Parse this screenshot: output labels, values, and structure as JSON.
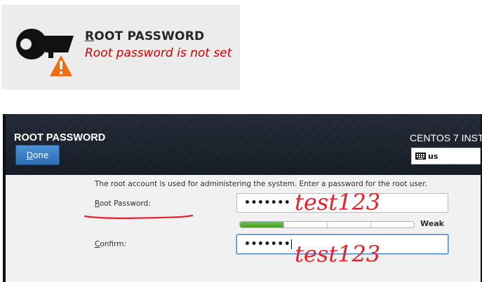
{
  "spoke": {
    "title_first": "R",
    "title_rest": "OOT PASSWORD",
    "status": "Root password is not set",
    "status_color": "#cc0000",
    "icon": "key-warning-icon"
  },
  "dialog": {
    "header_title": "ROOT PASSWORD",
    "done_first": "D",
    "done_rest": "one",
    "product": "CENTOS 7 INST",
    "keyboard_layout": "us",
    "keyboard_icon": "keyboard-icon",
    "accent": "#3a7ac4"
  },
  "form": {
    "description": "The root account is used for administering the system.  Enter a password for the root user.",
    "root_label_first": "R",
    "root_label_rest": "oot Password:",
    "root_value": "•••••••",
    "confirm_label_first": "C",
    "confirm_label_rest": "onfirm:",
    "confirm_value": "•••••••",
    "strength_label": "Weak",
    "strength_level": 0.25
  },
  "annotations": {
    "root_note": "test123",
    "confirm_note": "test123",
    "ink_color": "#e8202a"
  }
}
